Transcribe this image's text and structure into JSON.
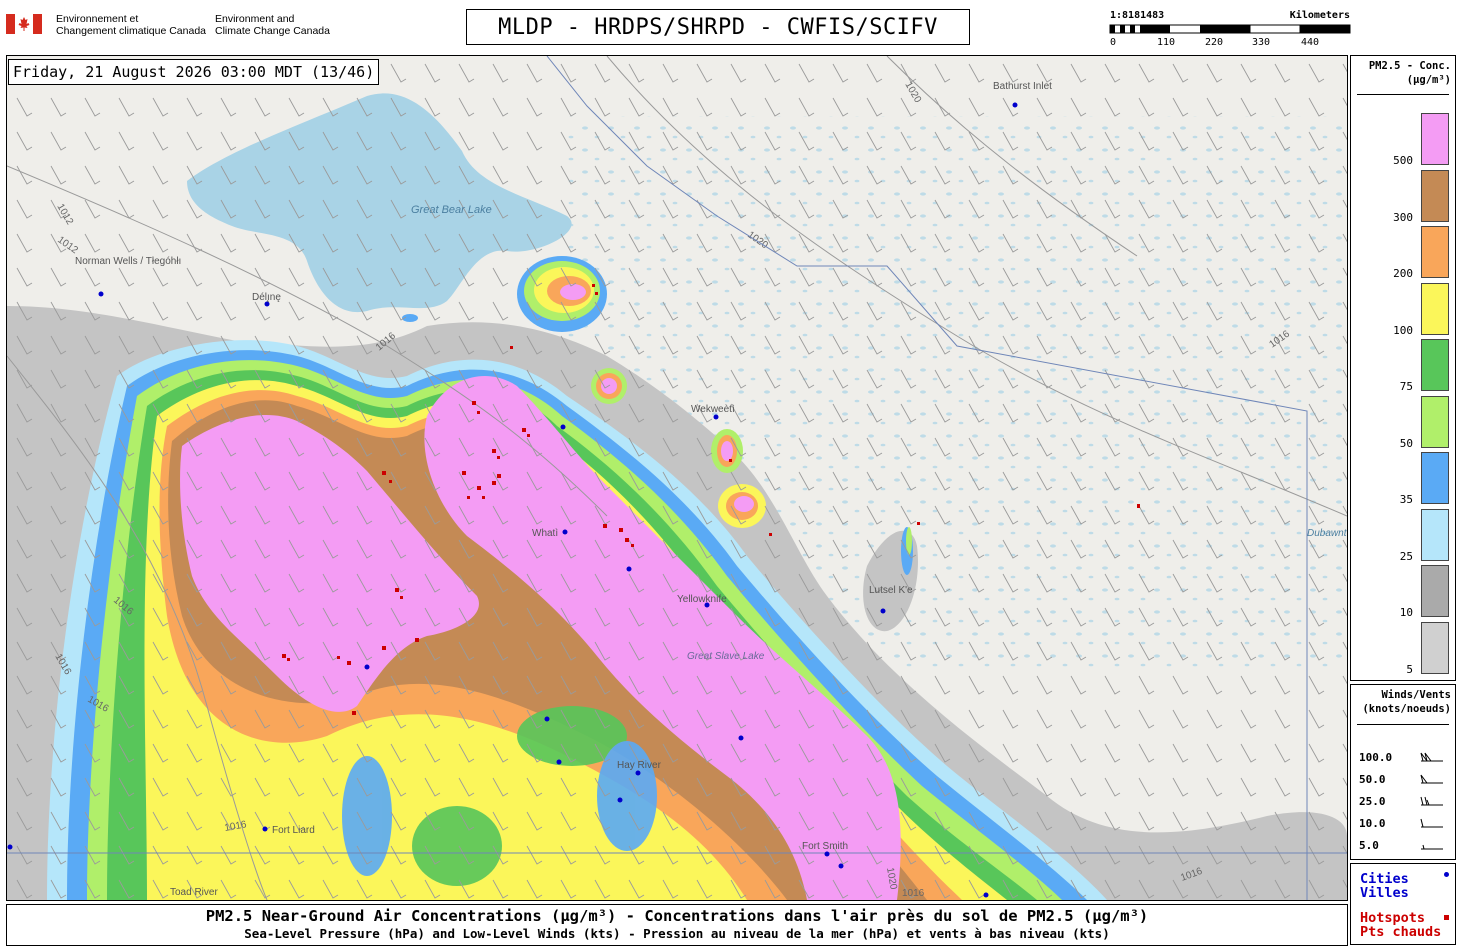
{
  "header": {
    "agency_fr_line1": "Environnement et",
    "agency_fr_line2": "Changement climatique Canada",
    "agency_en_line1": "Environment and",
    "agency_en_line2": "Climate Change Canada",
    "title": "MLDP - HRDPS/SHRPD - CWFIS/SCIFV"
  },
  "scale": {
    "ratio": "1:8181483",
    "unit": "Kilometers",
    "ticks": [
      "0",
      "110",
      "220",
      "330",
      "440"
    ]
  },
  "map": {
    "datetime": "Friday, 21 August 2026 03:00 MDT (13/46)",
    "place_labels": [
      "Bathurst Inlet",
      "Great Bear Lake",
      "Norman Wells / Tłegóhłı",
      "Délı̨nę",
      "Wekweètì",
      "Whatì",
      "Yellowknife",
      "Great Slave Lake",
      "Lutsel K'e",
      "Hay River",
      "Fort Smith",
      "Fort Liard",
      "Toad River",
      "Dubawnt Lake"
    ],
    "isobar_labels": [
      "1020",
      "1020",
      "1016",
      "1012",
      "1012",
      "1016",
      "1016",
      "1016",
      "1016",
      "1016",
      "1020",
      "1016",
      "1016"
    ]
  },
  "legend_pm": {
    "title_line1": "PM2.5 - Conc.",
    "title_line2": "(µg/m³)",
    "levels": [
      {
        "label": "500",
        "color": "#f49cf4"
      },
      {
        "label": "300",
        "color": "#c48a55"
      },
      {
        "label": "200",
        "color": "#f9a65a"
      },
      {
        "label": "100",
        "color": "#fbf65a"
      },
      {
        "label": "75",
        "color": "#58c65a"
      },
      {
        "label": "50",
        "color": "#b0ef6a"
      },
      {
        "label": "35",
        "color": "#5aaaf5"
      },
      {
        "label": "25",
        "color": "#b5e6fa"
      },
      {
        "label": "10",
        "color": "#aaaaaa"
      },
      {
        "label": "5",
        "color": "#d0d0d0"
      }
    ]
  },
  "legend_wind": {
    "title_line1": "Winds/Vents",
    "title_line2": "(knots/noeuds)",
    "speeds": [
      "100.0",
      "50.0",
      "25.0",
      "10.0",
      "5.0"
    ]
  },
  "legend_points": {
    "cities_en": "Cities",
    "cities_fr": "Villes",
    "hotspots_en": "Hotspots",
    "hotspots_fr": "Pts chauds",
    "city_color": "#0000cc",
    "hotspot_color": "#cc0000"
  },
  "footer": {
    "line1": "PM2.5 Near-Ground Air Concentrations (µg/m³) - Concentrations dans l'air près du sol de PM2.5 (µg/m³)",
    "line2": "Sea-Level Pressure (hPa) and Low-Level Winds (kts) - Pression au niveau de la mer (hPa) et vents à bas niveau (kts)"
  }
}
